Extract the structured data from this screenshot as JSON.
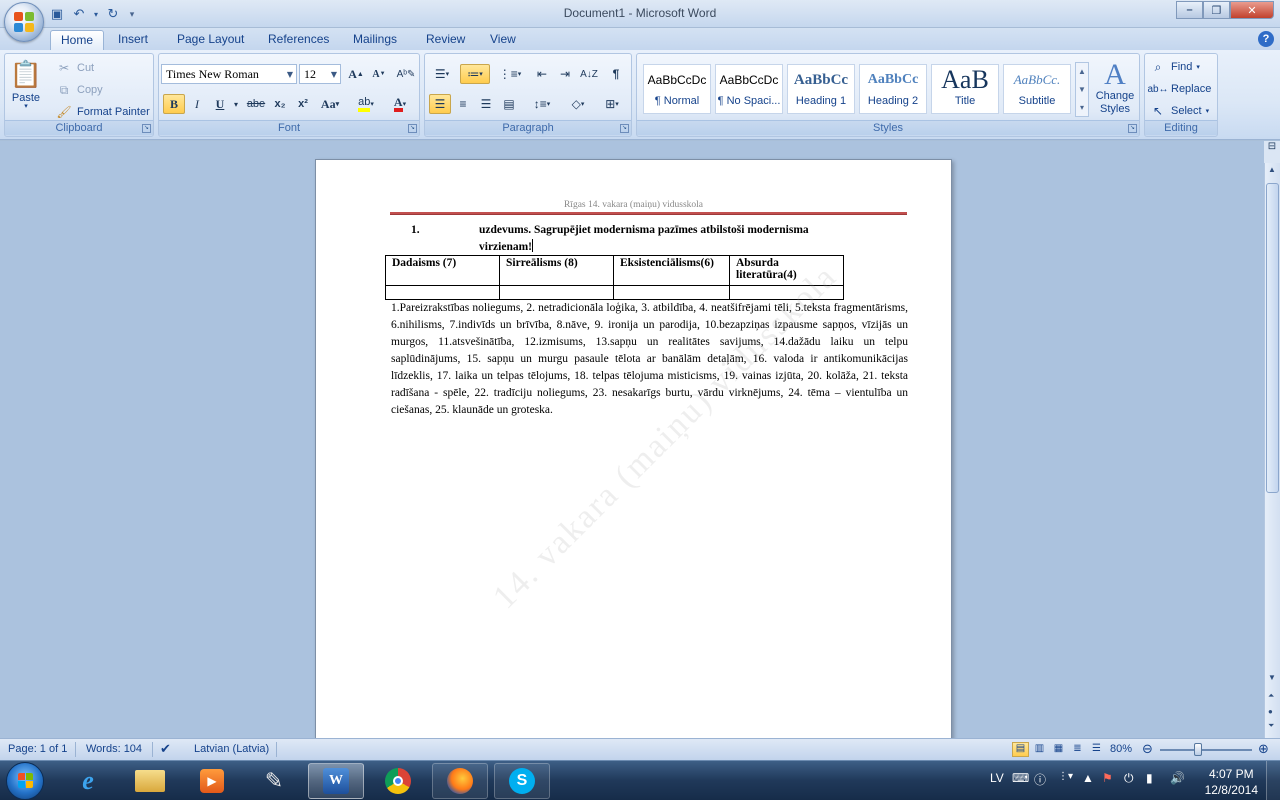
{
  "window": {
    "title": "Document1 - Microsoft Word"
  },
  "tabs": [
    "Home",
    "Insert",
    "Page Layout",
    "References",
    "Mailings",
    "Review",
    "View"
  ],
  "clipboard": {
    "paste": "Paste",
    "cut": "Cut",
    "copy": "Copy",
    "format_painter": "Format Painter",
    "label": "Clipboard"
  },
  "font": {
    "name": "Times New Roman",
    "size": "12",
    "label": "Font",
    "bold": "B",
    "italic": "I",
    "underline": "U",
    "strike": "abe",
    "sub": "x₂",
    "sup": "x²",
    "case": "Aa",
    "grow": "A",
    "shrink": "A"
  },
  "paragraph": {
    "label": "Paragraph"
  },
  "styles": {
    "label": "Styles",
    "items": [
      {
        "preview": "AaBbCcDc",
        "name": "¶ Normal"
      },
      {
        "preview": "AaBbCcDc",
        "name": "¶ No Spaci..."
      },
      {
        "preview": "AaBbCc",
        "name": "Heading 1"
      },
      {
        "preview": "AaBbCc",
        "name": "Heading 2"
      },
      {
        "preview": "AaB",
        "name": "Title"
      },
      {
        "preview": "AaBbCc.",
        "name": "Subtitle"
      }
    ],
    "change": "Change Styles"
  },
  "editing": {
    "find": "Find",
    "replace": "Replace",
    "select": "Select",
    "label": "Editing"
  },
  "document": {
    "header": "Rīgas 14. vakara (maiņu) vidusskola",
    "task_number": "1.",
    "task_line1": "uzdevums. Sagrupējiet modernisma pazīmes atbilstoši modernisma",
    "task_line2": "virzienam!",
    "table_headers": [
      "Dadaisms (7)",
      "Sirreālisms (8)",
      "Eksistenciālisms(6)",
      "Absurda literatūra(4)"
    ],
    "body": "1.Pareizrakstības noliegums, 2. netradicionāla loģika, 3. atbildība, 4. neatšifrējami tēli, 5.teksta fragmentārisms, 6.nihilisms, 7.indivīds un brīvība, 8.nāve, 9. ironija un parodija, 10.bezapziņas izpausme sapņos, vīzijās un murgos, 11.atsvešinātība, 12.izmisums, 13.sapņu un realitātes savijums, 14.dažādu laiku un telpu saplūdinājums, 15. sapņu un murgu pasaule tēlota ar banālām detaļām, 16. valoda ir antikomunikācijas līdzeklis, 17. laika un telpas tēlojums, 18. telpas tēlojuma misticisms, 19. vainas izjūta, 20. kolāža, 21. teksta radīšana - spēle, 22. tradīciju noliegums, 23. nesakarīgs burtu, vārdu virknējums, 24. tēma – vientulība un ciešanas, 25. klaunāde un groteska.",
    "watermark": "14. vakara (maiņu) vidusskola"
  },
  "status": {
    "page": "Page: 1 of 1",
    "words": "Words: 104",
    "language": "Latvian (Latvia)",
    "zoom": "80%"
  },
  "taskbar": {
    "lang": "LV",
    "time": "4:07 PM",
    "date": "12/8/2014"
  }
}
